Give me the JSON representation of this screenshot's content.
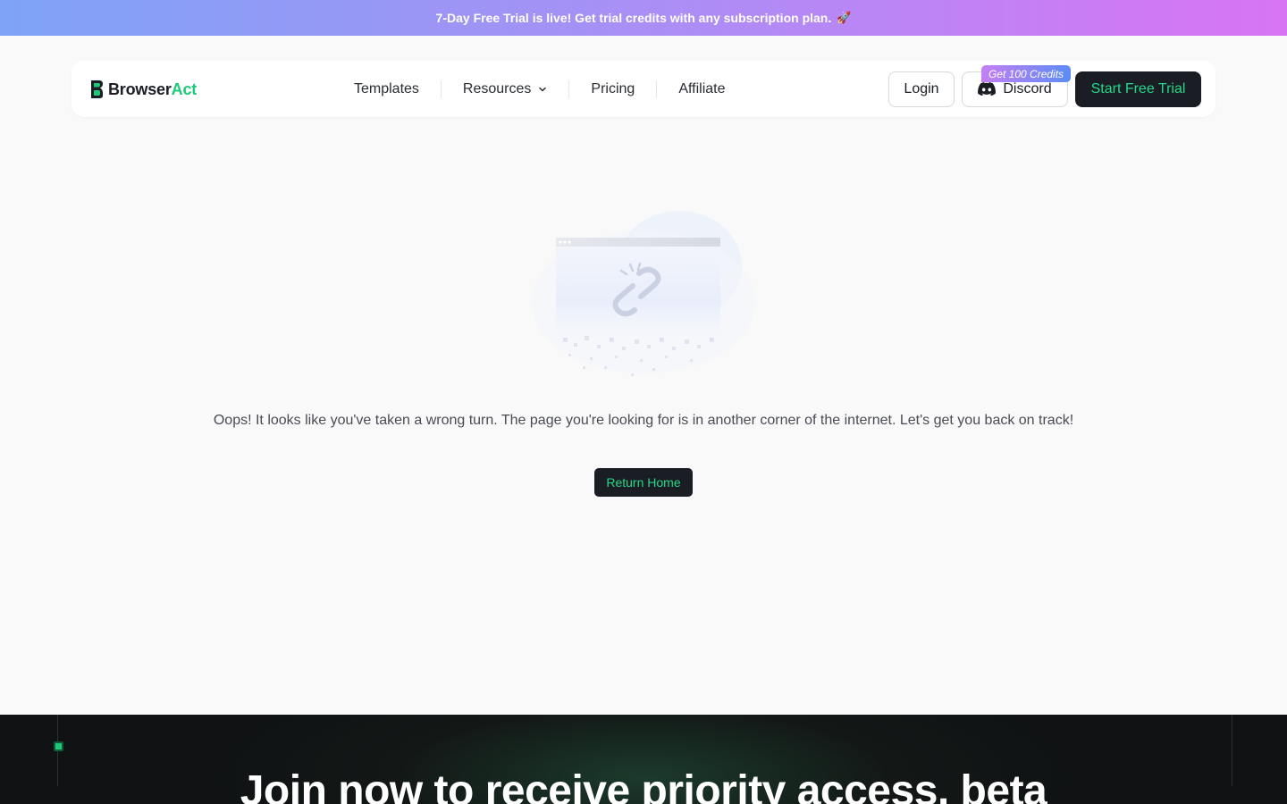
{
  "banner": {
    "text": "7-Day Free Trial is live! Get trial credits with any subscription plan.",
    "icon": "rocket-icon"
  },
  "brand": {
    "name_part1": "Browser",
    "name_part2": "Act",
    "accent_color": "#1ec97a",
    "dark_color": "#1b1d24"
  },
  "nav": {
    "items": [
      {
        "label": "Templates"
      },
      {
        "label": "Resources",
        "has_dropdown": true
      },
      {
        "label": "Pricing"
      },
      {
        "label": "Affiliate"
      }
    ]
  },
  "actions": {
    "login_label": "Login",
    "discord_label": "Discord",
    "credits_badge": "Get 100 Credits",
    "trial_label": "Start Free Trial"
  },
  "error": {
    "illustration": "broken-link-icon",
    "message": "Oops! It looks like you've taken a wrong turn. The page you're looking for is in another corner of the internet. Let's get you back on track!",
    "button_label": "Return Home"
  },
  "footer": {
    "title": "Join now to receive priority access, beta"
  }
}
